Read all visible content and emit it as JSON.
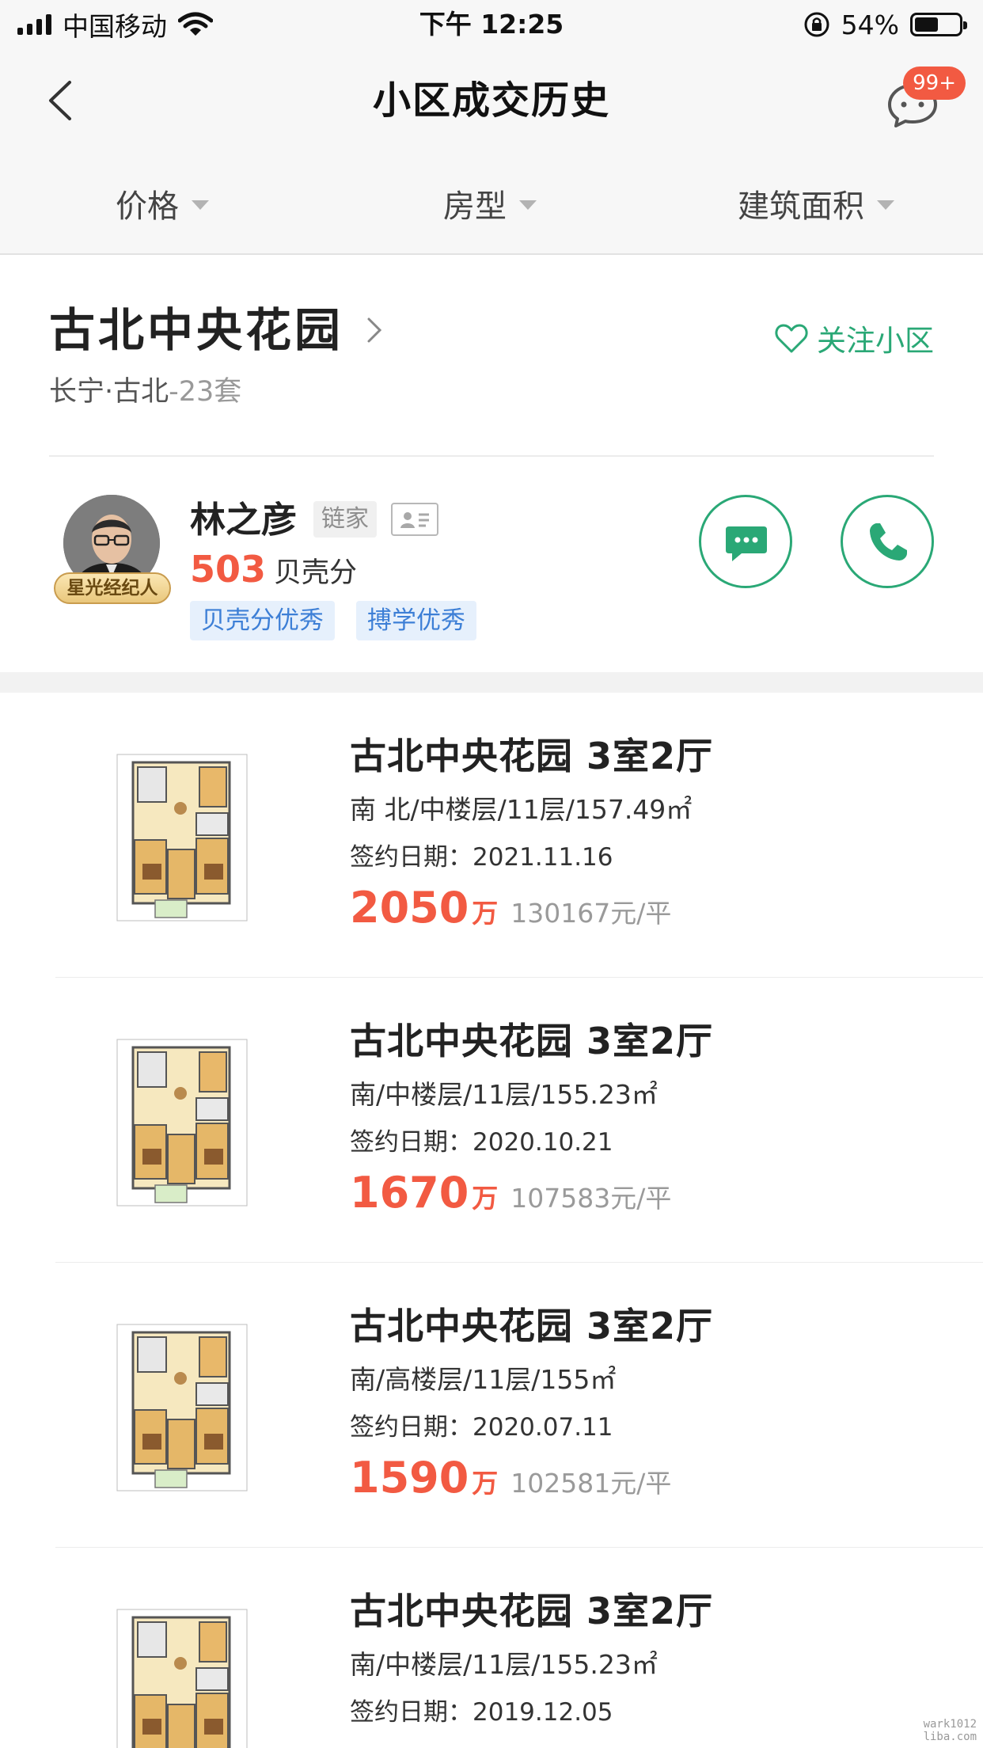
{
  "status_bar": {
    "carrier": "中国移动",
    "time": "下午 12:25",
    "battery_percent": "54%",
    "battery_level": 0.54
  },
  "nav": {
    "title": "小区成交历史",
    "message_badge": "99+"
  },
  "filters": [
    {
      "label": "价格"
    },
    {
      "label": "房型"
    },
    {
      "label": "建筑面积"
    }
  ],
  "community": {
    "name": "古北中央花园",
    "location": "长宁·古北",
    "count": "-23套",
    "follow_label": "关注小区"
  },
  "agent": {
    "badge": "星光经纪人",
    "name": "林之彦",
    "brand": "链家",
    "score": "503",
    "score_label": "贝壳分",
    "tags": [
      "贝壳分优秀",
      "搏学优秀"
    ]
  },
  "listings": [
    {
      "title": "古北中央花园 3室2厅",
      "spec": "南 北/中楼层/11层/157.49㎡",
      "date_label": "签约日期：",
      "date": "2021.11.16",
      "total": "2050",
      "unit": "万",
      "per_sqm": "130167元/平"
    },
    {
      "title": "古北中央花园 3室2厅",
      "spec": "南/中楼层/11层/155.23㎡",
      "date_label": "签约日期：",
      "date": "2020.10.21",
      "total": "1670",
      "unit": "万",
      "per_sqm": "107583元/平"
    },
    {
      "title": "古北中央花园 3室2厅",
      "spec": "南/高楼层/11层/155㎡",
      "date_label": "签约日期：",
      "date": "2020.07.11",
      "total": "1590",
      "unit": "万",
      "per_sqm": "102581元/平"
    },
    {
      "title": "古北中央花园 3室2厅",
      "spec": "南/中楼层/11层/155.23㎡",
      "date_label": "签约日期：",
      "date": "2019.12.05",
      "total": "",
      "unit": "",
      "per_sqm": ""
    }
  ],
  "watermark": [
    "wark1012",
    "liba.com"
  ],
  "icons": {
    "back": "chevron-left-icon",
    "message": "chat-bubble-icon",
    "follow": "heart-outline-icon",
    "chat": "chat-dots-icon",
    "phone": "phone-icon",
    "community_arrow": "chevron-right-icon"
  },
  "colors": {
    "accent_green": "#2aa876",
    "price_red": "#f25a42",
    "tag_blue": "#3d7fd6",
    "tag_bg": "#e6f0fc"
  }
}
